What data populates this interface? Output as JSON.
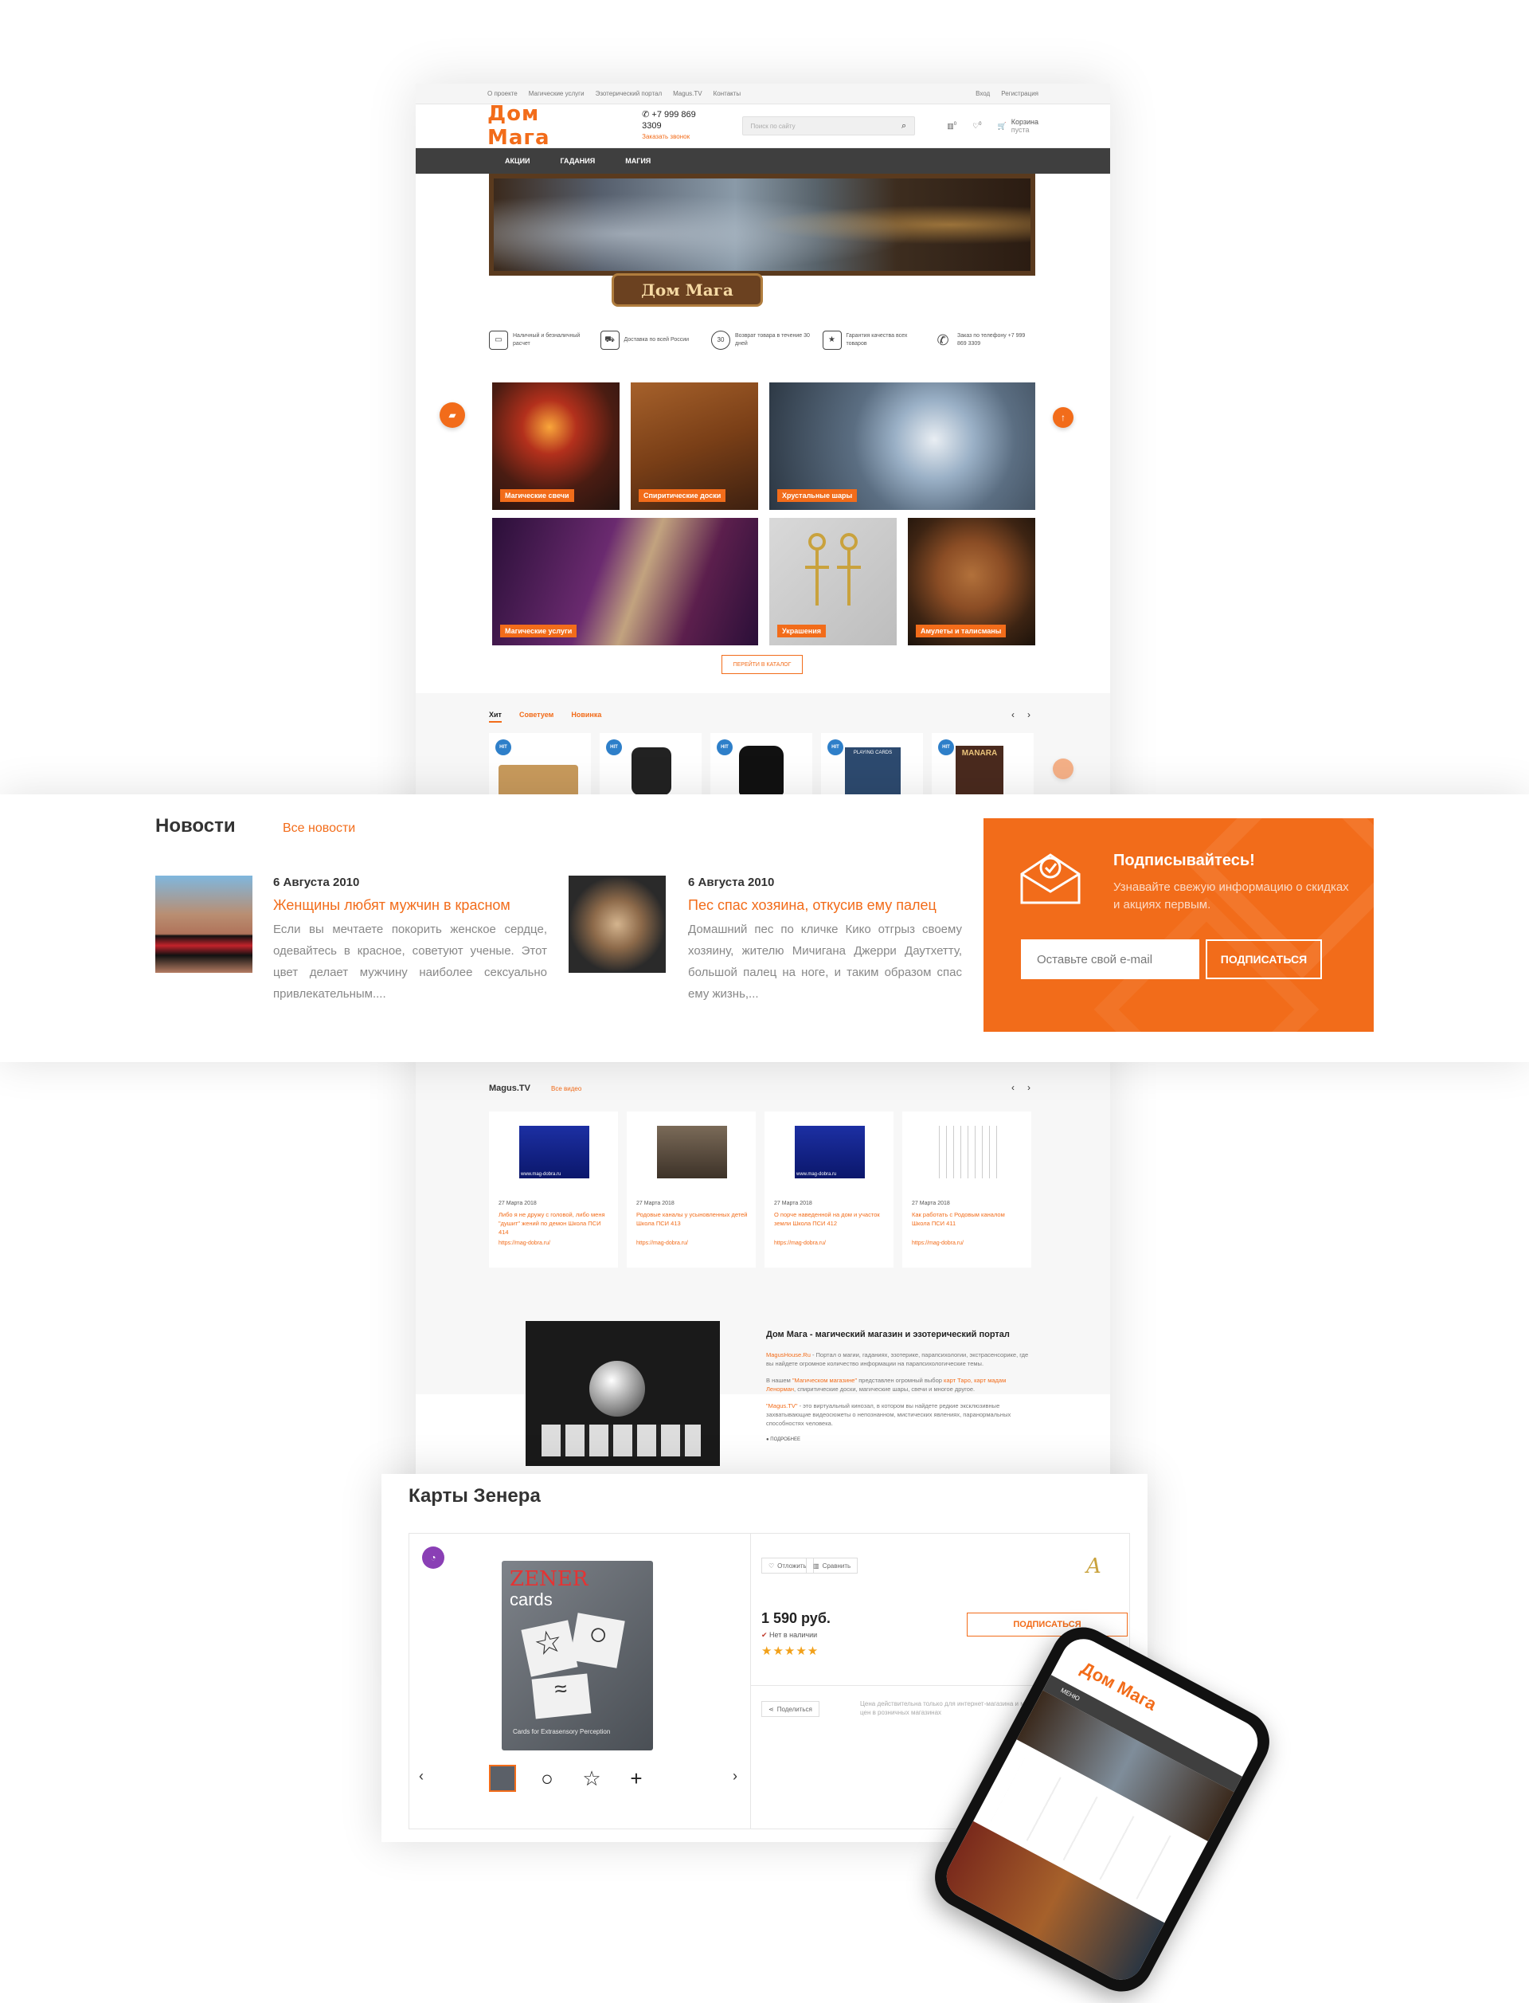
{
  "topbar": {
    "links": [
      "О проекте",
      "Магические услуги",
      "Эзотерический портал",
      "Magus.TV",
      "Контакты"
    ],
    "login": "Вход",
    "register": "Регистрация"
  },
  "header": {
    "logo": "Дом Мага",
    "phone": "+7 999 869 3309",
    "callback": "Заказать звонок",
    "search_placeholder": "Поиск по сайту",
    "compare_count": "0",
    "fav_count": "0",
    "cart_label": "Корзина",
    "cart_status": "пуста"
  },
  "nav": [
    "АКЦИИ",
    "ГАДАНИЯ",
    "МАГИЯ"
  ],
  "banner": {
    "logo": "Дом Мага"
  },
  "features": [
    {
      "icon": "wallet-icon",
      "glyph": "▭",
      "text": "Наличный и безналичный расчет"
    },
    {
      "icon": "truck-icon",
      "glyph": "⛟",
      "text": "Доставка по всей России"
    },
    {
      "icon": "return-30-icon",
      "glyph": "30",
      "text": "Возврат товара в течение 30 дней"
    },
    {
      "icon": "shield-star-icon",
      "glyph": "★",
      "text": "Гарантия качества всех товаров"
    },
    {
      "icon": "phone-call-icon",
      "glyph": "✆",
      "text": "Заказ по телефону +7 999 869 3309"
    }
  ],
  "categories": [
    "Магические свечи",
    "Спиритические доски",
    "Хрустальные шары",
    "Магические услуги",
    "Украшения",
    "Амулеты и талисманы"
  ],
  "catalog_button": "ПЕРЕЙТИ В КАТАЛОГ",
  "product_tabs": [
    "Хит",
    "Советуем",
    "Новинка"
  ],
  "hit_badge": "HIT",
  "product_cards": [
    {
      "badge": "HIT"
    },
    {
      "badge": "HIT"
    },
    {
      "badge": "HIT"
    },
    {
      "badge": "HIT",
      "text": "PLAYING CARDS"
    },
    {
      "badge": "HIT",
      "text": "MANARA"
    }
  ],
  "news": {
    "title": "Новости",
    "all": "Все новости",
    "items": [
      {
        "date": "6 Августа 2010",
        "title": "Женщины любят мужчин в красном",
        "body": "Если вы мечтаете покорить женское сердце, одевайтесь в красное, советуют ученые. Этот цвет делает мужчину наиболее сексуально привлекательным...."
      },
      {
        "date": "6 Августа 2010",
        "title": "Пес спас хозяина, откусив ему палец",
        "body": "Домашний пес по кличке Кико отгрыз своему хозяину, жителю Мичигана Джерри Даутхетту, большой палец на ноге, и таким образом спас ему жизнь,..."
      }
    ]
  },
  "subscribe": {
    "title": "Подписывайтесь!",
    "text": "Узнавайте свежую информацию о скидках и акциях первым.",
    "placeholder": "Оставьте свой e-mail",
    "button": "ПОДПИСАТЬСЯ"
  },
  "tv": {
    "title": "Magus.TV",
    "all": "Все видео",
    "items": [
      {
        "date": "27 Марта 2018",
        "title": "Либо я не дружу с головой, либо меня \"душит\" жений по демон Школа ПСИ 414",
        "link": "https://mag-dobra.ru/",
        "screen_text": "www.mag-dobra.ru"
      },
      {
        "date": "27 Марта 2018",
        "title": "Родовые каналы у усыновленных детей Школа ПСИ 413",
        "link": "https://mag-dobra.ru/"
      },
      {
        "date": "27 Марта 2018",
        "title": "О порче наведенной на дом и участок земли Школа ПСИ 412",
        "link": "https://mag-dobra.ru/",
        "screen_text": "www.mag-dobra.ru"
      },
      {
        "date": "27 Марта 2018",
        "title": "Как работать с Родовым каналом Школа ПСИ 411",
        "link": "https://mag-dobra.ru/"
      }
    ]
  },
  "about": {
    "title": "Дом Мага - магический магазин и эзотерический портал",
    "p1_link": "MagusHouse.Ru",
    "p1": " - Портал о магии, гаданиях, эзотерике, парапсихологии, экстрасенсорике, где вы найдете огромное количество информации на парапсихологические темы.",
    "p2_a": "В нашем ",
    "p2_link": "\"Магическом магазине\"",
    "p2_b": " представлен огромный выбор ",
    "p2_link2": "карт Таро, карт мадам Ленорман",
    "p2_c": ", спиритические доски, магические шары, свечи и многое другое.",
    "p3_link": "\"Magus.TV\"",
    "p3": " - это виртуальный кинозал, в котором вы найдете редкие эксклюзивные захватывающие видеосюжеты о непознанном, мистических явлениях, паранормальных способностях человека.",
    "more": "ПОДРОБНЕЕ"
  },
  "product": {
    "title": "Карты Зенера",
    "box_brand": "ZENER",
    "box_sub": "cards",
    "box_caption": "Cards for Extrasensory Perception",
    "defer": "Отложить",
    "compare": "Сравнить",
    "price": "1 590 руб.",
    "stock": "Нет в наличии",
    "stars": "★★★★★",
    "subscribe": "ПОДПИСАТЬСЯ",
    "share": "Поделиться",
    "note": "Цена действительна только для интернет-магазина и может отличаться от цен в розничных магазинах",
    "thumbs": [
      "",
      "○",
      "☆",
      "+"
    ]
  },
  "mobile": {
    "logo": "Дом Мага",
    "nav": "МЕНЮ"
  },
  "colors": {
    "accent": "#f26c1a",
    "nav_bg": "#3f3f3f",
    "hit": "#2e7fc9"
  }
}
